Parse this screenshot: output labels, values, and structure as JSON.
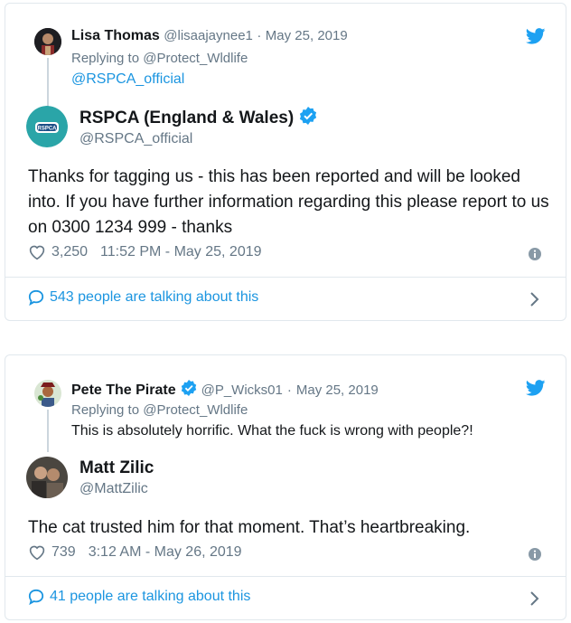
{
  "tweets": [
    {
      "context": {
        "name": "Lisa Thomas",
        "handle": "@lisaajaynee1",
        "separator": "·",
        "date": "May 25, 2019",
        "replying_prefix": "Replying to",
        "replying_handle": "@Protect_Wldlife",
        "mention_line": "@RSPCA_official"
      },
      "author": {
        "name": "RSPCA (England & Wales)",
        "handle": "@RSPCA_official",
        "avatar_label": "RSPCA"
      },
      "text": "Thanks for tagging us - this has been reported and will be looked into. If you have further information regarding this please report to us on 0300 1234 999 - thanks",
      "likes": "3,250",
      "timestamp": "11:52 PM - May 25, 2019",
      "talking": "543 people are talking about this"
    },
    {
      "context": {
        "name": "Pete The Pirate",
        "handle": "@P_Wicks01",
        "separator": "·",
        "date": "May 25, 2019",
        "replying_prefix": "Replying to",
        "replying_handle": "@Protect_Wldlife",
        "quote": "This is absolutely horrific. What the fuck is wrong with people?!"
      },
      "author": {
        "name": "Matt Zilic",
        "handle": "@MattZilic"
      },
      "text": "The cat trusted him for that moment. That’s heartbreaking.",
      "likes": "739",
      "timestamp": "3:12 AM - May 26, 2019",
      "talking": "41 people are talking about this"
    }
  ],
  "colors": {
    "twitter_blue": "#1da1f2",
    "link_blue": "#1b95e0",
    "muted_gray": "#657786",
    "border": "#e1e8ed",
    "rspca_teal": "#2aa5a8"
  }
}
